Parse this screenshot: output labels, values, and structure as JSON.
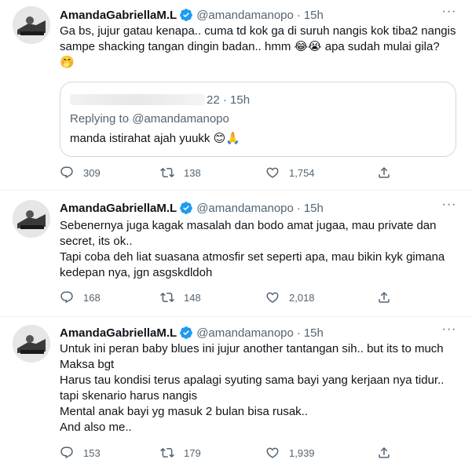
{
  "tweets": [
    {
      "name": "AmandaGabriellaM.L",
      "handle": "@amandamanopo",
      "dot": "·",
      "time": "15h",
      "lines": [
        "Ga bs, jujur gatau kenapa.. cuma td kok ga di suruh nangis kok tiba2 nangis",
        "sampe shacking tangan dingin badan.. hmm 😂😭 apa sudah mulai gila?",
        "🤭"
      ],
      "quote": {
        "time_partial": "22 · 15h",
        "replying_label": "Replying to",
        "replying_mention": "@amandamanopo",
        "text": "manda istirahat ajah yuukk 😊🙏"
      },
      "replies": "309",
      "retweets": "138",
      "likes": "1,754"
    },
    {
      "name": "AmandaGabriellaM.L",
      "handle": "@amandamanopo",
      "dot": "·",
      "time": "15h",
      "lines": [
        "Sebenernya juga kagak masalah dan bodo amat jugaa, mau private dan",
        "secret, its ok..",
        "Tapi coba deh liat suasana atmosfir set seperti apa, mau bikin kyk gimana",
        "kedepan nya, jgn asgskdldoh"
      ],
      "replies": "168",
      "retweets": "148",
      "likes": "2,018"
    },
    {
      "name": "AmandaGabriellaM.L",
      "handle": "@amandamanopo",
      "dot": "·",
      "time": "15h",
      "lines": [
        "Untuk ini peran baby blues ini jujur another tantangan sih.. but its to much",
        "Maksa bgt",
        "Harus tau kondisi terus apalagi syuting sama bayi yang kerjaan nya tidur..",
        "tapi skenario harus nangis",
        "Mental anak bayi yg masuk 2 bulan bisa rusak..",
        "And also me.."
      ],
      "replies": "153",
      "retweets": "179",
      "likes": "1,939"
    }
  ],
  "icons": {
    "avatar": "avatar-image",
    "verified": "verified-badge-icon",
    "more": "more-options-icon",
    "reply": "reply-icon",
    "retweet": "retweet-icon",
    "like": "heart-icon",
    "share": "share-icon"
  },
  "colors": {
    "text": "#0f1419",
    "secondary": "#536471",
    "verified": "#1d9bf0",
    "divider": "#eff3f4",
    "quote_border": "#cfd9de"
  }
}
